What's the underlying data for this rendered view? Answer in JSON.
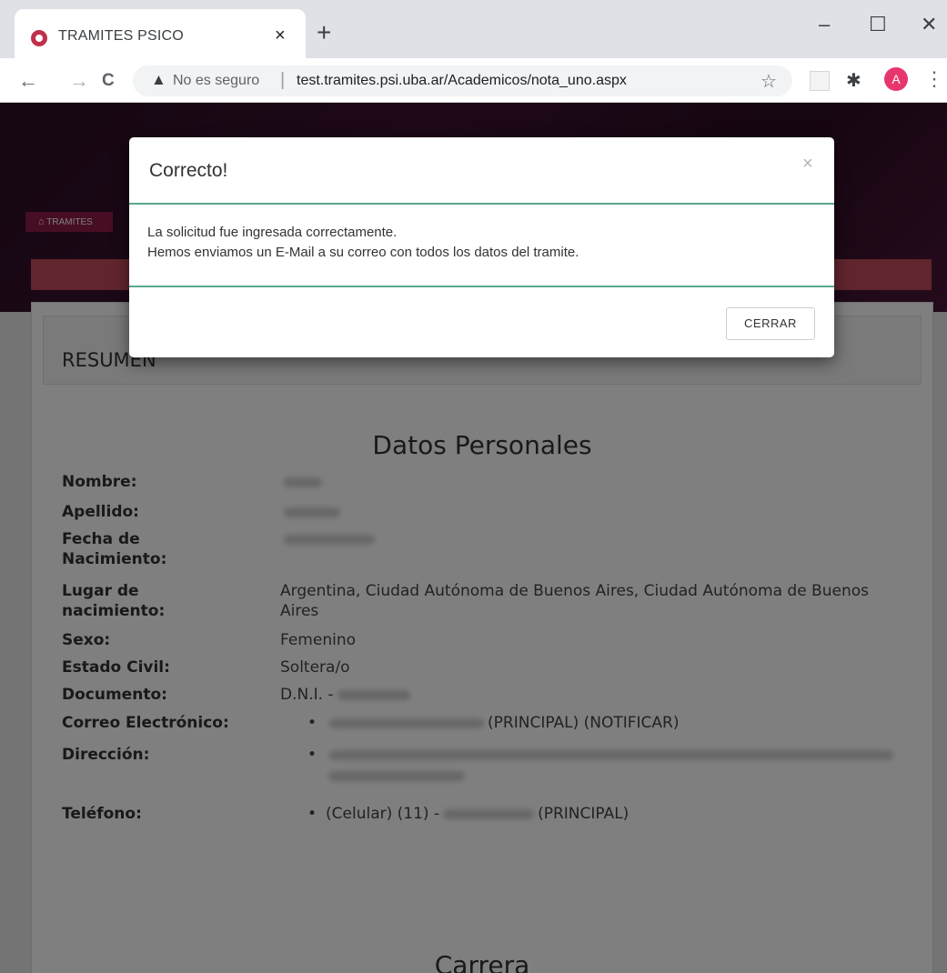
{
  "browser": {
    "tab_title": "TRAMITES PSICO",
    "tab_close": "×",
    "new_tab": "+",
    "minimize": "–",
    "maximize": "☐",
    "close": "✕",
    "back": "←",
    "forward": "→",
    "reload": "C",
    "security_warning_icon": "▲",
    "not_secure": "No es seguro",
    "separator": "|",
    "url": "test.tramites.psi.uba.ar/Academicos/nota_uno.aspx",
    "bookmark_icon": "☆",
    "extensions_icon": "✱",
    "profile_initial": "A",
    "menu_icon": "⋮"
  },
  "page": {
    "breadcrumb": "TRAMITES",
    "home_icon": "⌂",
    "panel_title": "RESUMEN",
    "section_personal": "Datos Personales",
    "section_carrera": "Carrera",
    "bullet": "•",
    "fields": {
      "nombre_label": "Nombre:",
      "apellido_label": "Apellido:",
      "fecha_label_1": "Fecha de",
      "fecha_label_2": "Nacimiento:",
      "lugar_label_1": "Lugar de",
      "lugar_label_2": "nacimiento:",
      "lugar_value_1": "Argentina, Ciudad Autónoma de Buenos Aires, Ciudad Autónoma de Buenos",
      "lugar_value_2": "Aires",
      "sexo_label": "Sexo:",
      "sexo_value": "Femenino",
      "estado_label": "Estado Civil:",
      "estado_value": "Soltera/o",
      "documento_label": "Documento:",
      "documento_value": "D.N.I. -",
      "correo_label": "Correo Electrónico:",
      "correo_suffix": "(PRINCIPAL) (NOTIFICAR)",
      "direccion_label": "Dirección:",
      "telefono_label": "Teléfono:",
      "telefono_prefix": "(Celular) (11) -",
      "telefono_suffix": "(PRINCIPAL)"
    }
  },
  "modal": {
    "title": "Correcto!",
    "close_icon": "×",
    "body_line1": "La solicitud fue ingresada correctamente.",
    "body_line2": "Hemos enviamos un E-Mail a su correo con todos los datos del tramite.",
    "button": "CERRAR"
  }
}
